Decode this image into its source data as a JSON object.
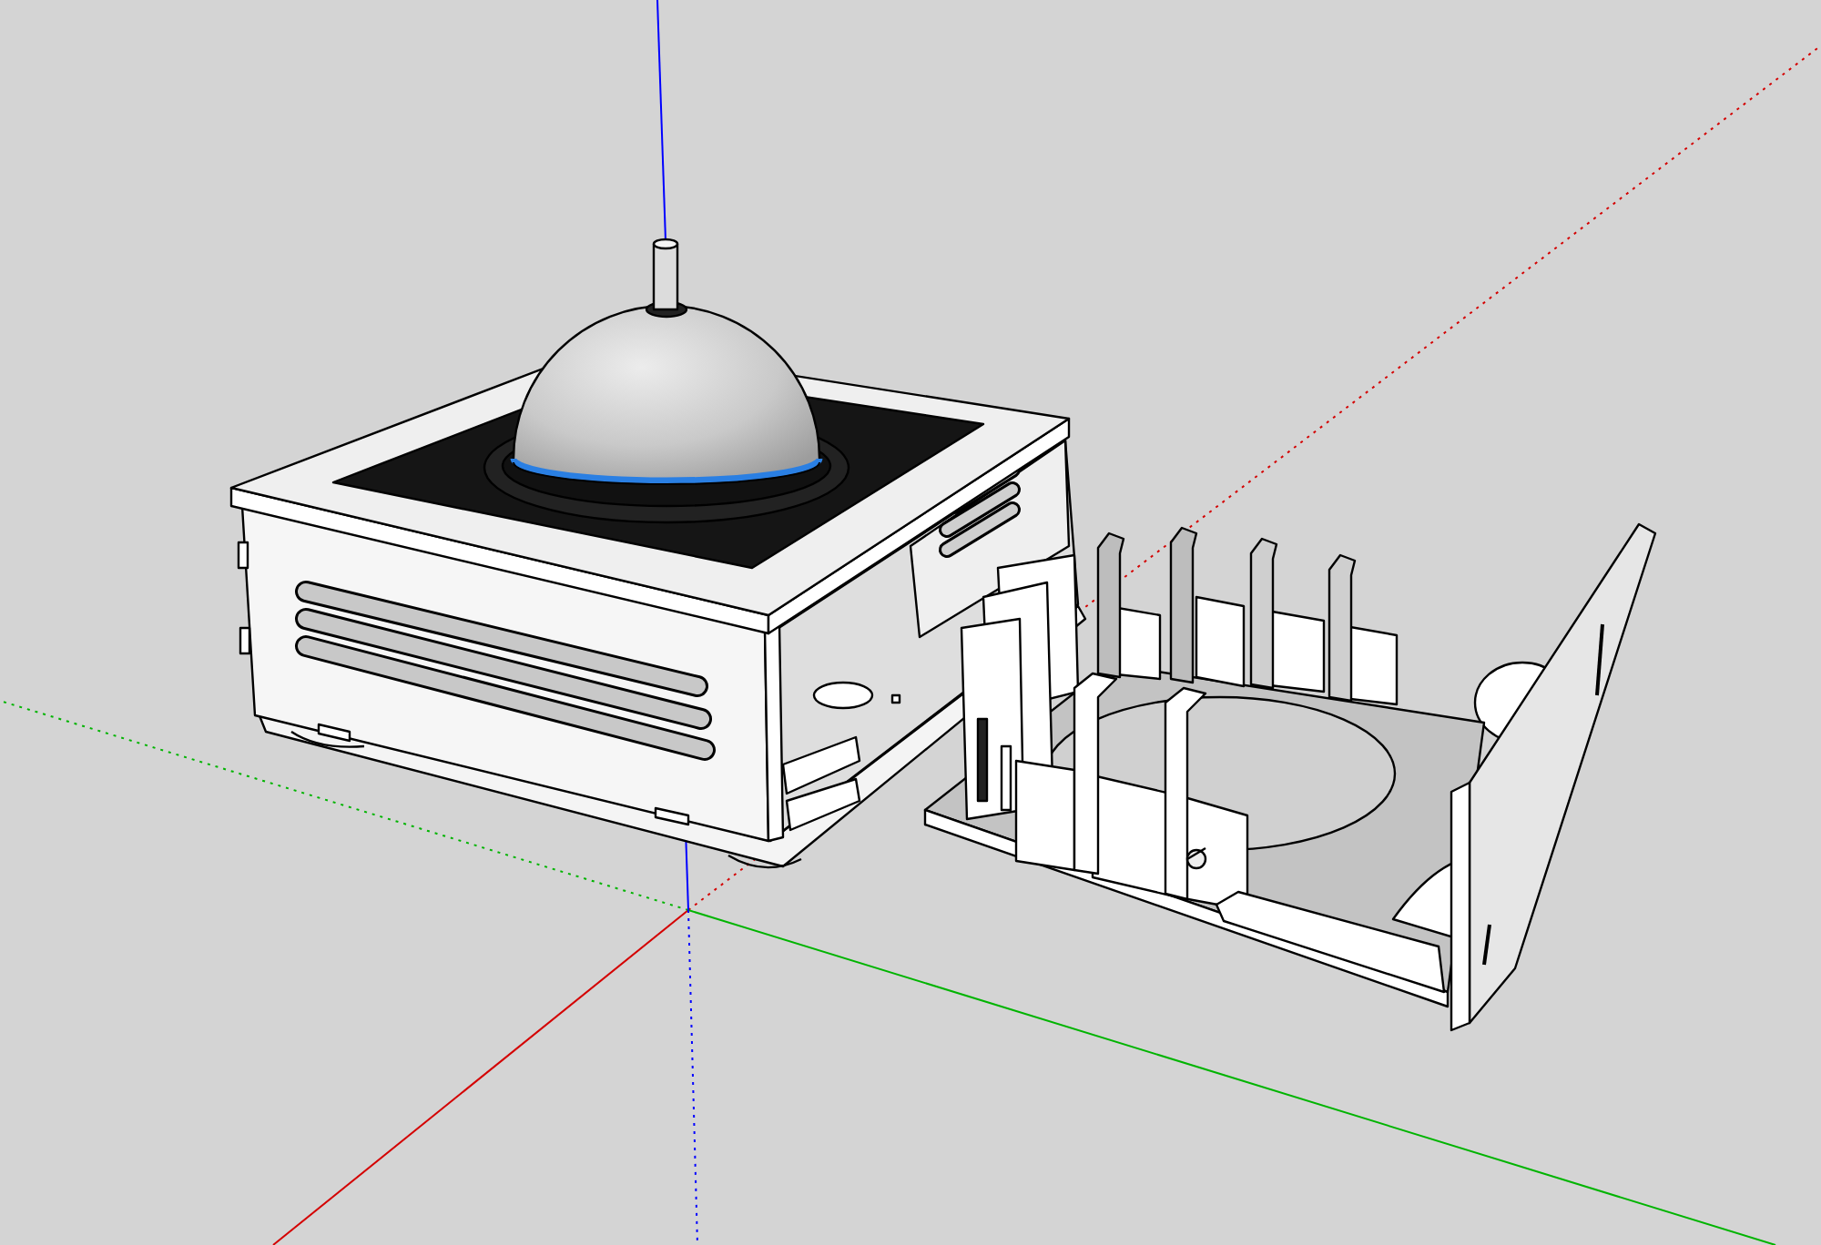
{
  "viewport": {
    "axes": [
      {
        "color": "#d40000"
      },
      {
        "color": "#00b400"
      },
      {
        "color": "#0000ff"
      }
    ]
  }
}
